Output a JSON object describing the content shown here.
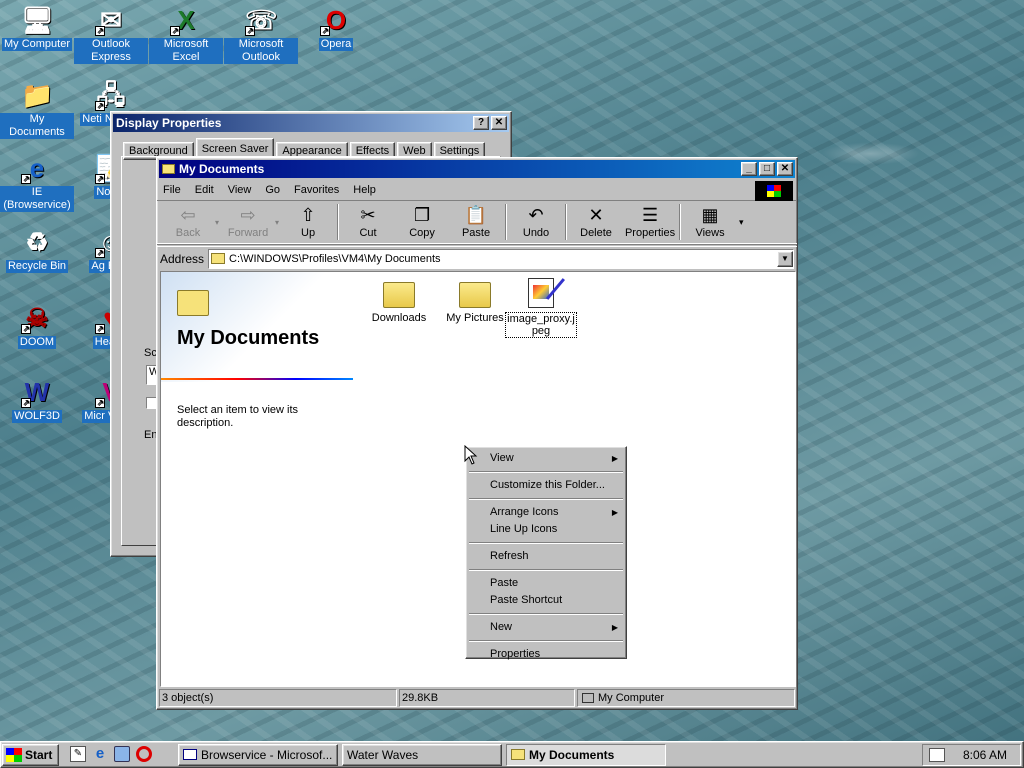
{
  "desktop_icons": [
    {
      "label": "My Computer",
      "icon": "computer-icon"
    },
    {
      "label": "Outlook Express",
      "icon": "outlook-express-icon"
    },
    {
      "label": "Microsoft Excel",
      "icon": "excel-icon"
    },
    {
      "label": "Microsoft Outlook",
      "icon": "outlook-icon"
    },
    {
      "label": "Opera",
      "icon": "opera-icon"
    },
    {
      "label": "My Documents",
      "icon": "folder-icon"
    },
    {
      "label": "Neti Neighb",
      "icon": "network-icon"
    },
    {
      "label": "IE (Browservice)",
      "icon": "ie-icon"
    },
    {
      "label": "Notep",
      "icon": "notepad-icon"
    },
    {
      "label": "Recycle Bin",
      "icon": "recycle-bin-icon"
    },
    {
      "label": "Ag Emp",
      "icon": "agent-icon"
    },
    {
      "label": "DOOM",
      "icon": "doom-icon"
    },
    {
      "label": "Hearts",
      "icon": "hearts-icon"
    },
    {
      "label": "WOLF3D",
      "icon": "wolf3d-icon"
    },
    {
      "label": "Micr Visual",
      "icon": "visual-icon"
    }
  ],
  "display_props": {
    "title": "Display Properties",
    "tabs": [
      "Background",
      "Screen Saver",
      "Appearance",
      "Effects",
      "Web",
      "Settings"
    ],
    "frag_sc": "Sc",
    "frag_w": "W",
    "frag_en": "En"
  },
  "explorer": {
    "title": "My Documents",
    "menu": [
      "File",
      "Edit",
      "View",
      "Go",
      "Favorites",
      "Help"
    ],
    "toolbar": [
      {
        "label": "Back",
        "glyph": "⇦",
        "disabled": true
      },
      {
        "label": "Forward",
        "glyph": "⇨",
        "disabled": true
      },
      {
        "label": "Up",
        "glyph": "⇧",
        "disabled": false
      },
      {
        "label": "Cut",
        "glyph": "✂",
        "disabled": false
      },
      {
        "label": "Copy",
        "glyph": "❐",
        "disabled": false
      },
      {
        "label": "Paste",
        "glyph": "📋",
        "disabled": false
      },
      {
        "label": "Undo",
        "glyph": "↶",
        "disabled": false
      },
      {
        "label": "Delete",
        "glyph": "✕",
        "disabled": false
      },
      {
        "label": "Properties",
        "glyph": "☰",
        "disabled": false
      },
      {
        "label": "Views",
        "glyph": "▦",
        "disabled": false
      }
    ],
    "address_label": "Address",
    "address_value": "C:\\WINDOWS\\Profiles\\VM4\\My Documents",
    "panel_title": "My Documents",
    "panel_desc": "Select an item to view its description.",
    "files": [
      {
        "name": "Downloads",
        "icon": "folder-icon"
      },
      {
        "name": "My Pictures",
        "icon": "folder-icon"
      },
      {
        "name": "image_proxy.jpeg",
        "icon": "image-file-icon"
      }
    ],
    "status": {
      "objects": "3 object(s)",
      "size": "29.8KB",
      "zone": "My Computer"
    }
  },
  "context_menu": [
    {
      "label": "View",
      "submenu": true
    },
    {
      "sep": true
    },
    {
      "label": "Customize this Folder...",
      "submenu": false
    },
    {
      "sep": true
    },
    {
      "label": "Arrange Icons",
      "submenu": true
    },
    {
      "label": "Line Up Icons",
      "submenu": false
    },
    {
      "sep": true
    },
    {
      "label": "Refresh",
      "submenu": false
    },
    {
      "sep": true
    },
    {
      "label": "Paste",
      "submenu": false
    },
    {
      "label": "Paste Shortcut",
      "submenu": false
    },
    {
      "sep": true
    },
    {
      "label": "New",
      "submenu": true
    },
    {
      "sep": true
    },
    {
      "label": "Properties",
      "submenu": false
    }
  ],
  "taskbar": {
    "start": "Start",
    "tasks": [
      "Browservice - Microsof...",
      "Water Waves",
      "My Documents"
    ],
    "clock": "8:06 AM"
  },
  "colors": {
    "titlebar_active": "#000080",
    "titlebar_inactive": "#808080",
    "face": "#c0c0c0"
  }
}
